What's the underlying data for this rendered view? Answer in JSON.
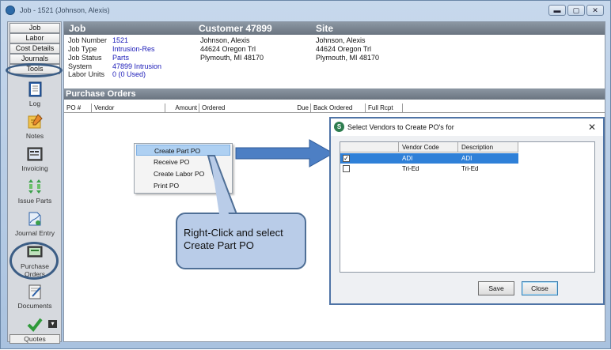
{
  "window": {
    "title": "Job - 1521 (Johnson, Alexis)"
  },
  "sidebar": {
    "tabs": [
      "Job",
      "Labor",
      "Cost Details",
      "Journals",
      "Tools"
    ],
    "tools": [
      "Log",
      "Notes",
      "Invoicing",
      "Issue Parts",
      "Journal Entry",
      "Purchase Orders",
      "Documents",
      "Quotes"
    ],
    "dropdown_glyph": "▾"
  },
  "header": {
    "job": "Job",
    "customer": "Customer 47899",
    "site": "Site"
  },
  "job_info": {
    "labels": [
      "Job Number",
      "Job Type",
      "Job Status",
      "System",
      "Labor Units"
    ],
    "values": [
      "1521",
      "Intrusion-Res",
      "Parts",
      "47899 Intrusion",
      "0 (0 Used)"
    ]
  },
  "customer_info": [
    "Johnson, Alexis",
    "44624 Oregon Trl",
    "Plymouth, MI  48170"
  ],
  "site_info": [
    "Johnson, Alexis",
    "44624 Oregon Trl",
    "Plymouth, MI  48170"
  ],
  "purchase_orders": {
    "title": "Purchase Orders",
    "columns": [
      "PO #",
      "Vendor",
      "Amount",
      "Ordered",
      "Due",
      "Back Ordered",
      "Full Rcpt"
    ]
  },
  "context_menu": {
    "items": [
      "Create Part PO",
      "Receive PO",
      "Create Labor PO",
      "Print PO"
    ]
  },
  "callout": {
    "text": "Right-Click and select Create Part PO"
  },
  "dialog": {
    "title": "Select Vendors to Create PO's for",
    "close_glyph": "✕",
    "columns": [
      "Vendor Code",
      "Description"
    ],
    "rows": [
      {
        "code": "ADI",
        "description": "ADI",
        "checked": true
      },
      {
        "code": "Tri-Ed",
        "description": "Tri-Ed",
        "checked": false
      }
    ],
    "save_label": "Save",
    "close_label": "Close"
  },
  "colors": {
    "accent": "#2f80d8",
    "header_gray": "#7a8591",
    "callout_fill": "#b9cce8",
    "arrow": "#4d7fc4"
  }
}
